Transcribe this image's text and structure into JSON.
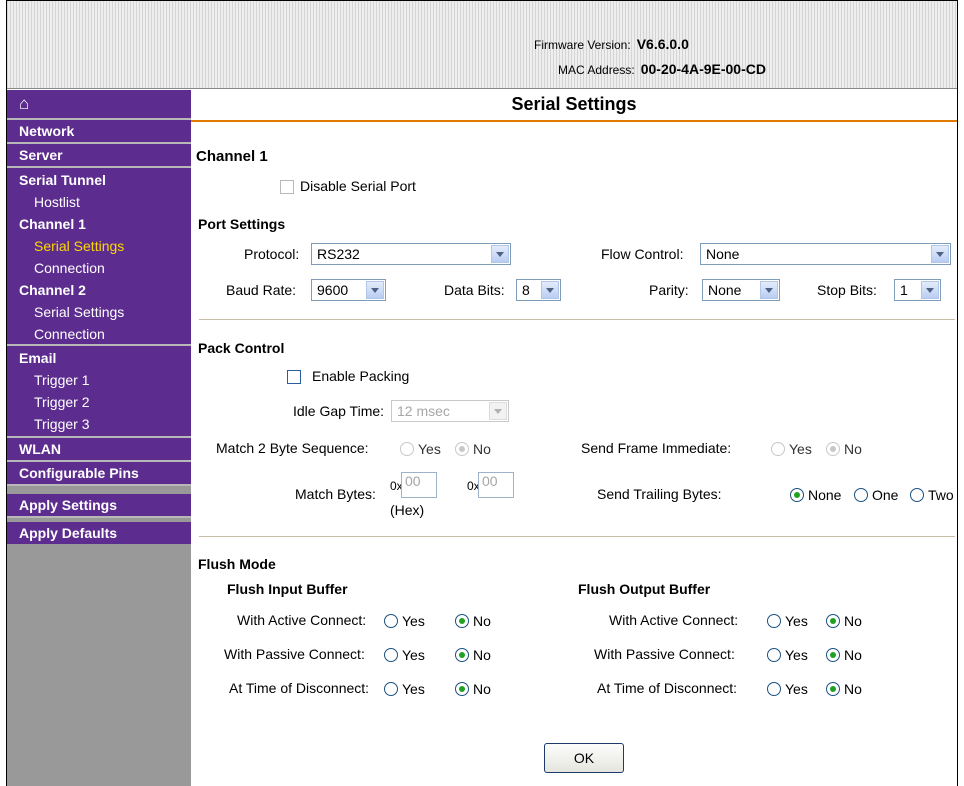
{
  "header": {
    "firmware_label": "Firmware Version:",
    "firmware_value": "V6.6.0.0",
    "mac_label": "MAC Address:",
    "mac_value": "00-20-4A-9E-00-CD"
  },
  "sidebar": {
    "home_icon": "home-icon",
    "network": "Network",
    "server": "Server",
    "serial_tunnel": "Serial Tunnel",
    "hostlist": "Hostlist",
    "channel1": "Channel 1",
    "ch1_serial_settings": "Serial Settings",
    "ch1_connection": "Connection",
    "channel2": "Channel 2",
    "ch2_serial_settings": "Serial Settings",
    "ch2_connection": "Connection",
    "email": "Email",
    "trigger1": "Trigger 1",
    "trigger2": "Trigger 2",
    "trigger3": "Trigger 3",
    "wlan": "WLAN",
    "configurable_pins": "Configurable Pins",
    "apply_settings": "Apply Settings",
    "apply_defaults": "Apply Defaults",
    "active_item_color": "#ffd700",
    "bg_color": "#5c2d8e"
  },
  "page": {
    "title": "Serial Settings",
    "accent_color": "#e07b00"
  },
  "channel": {
    "title": "Channel 1",
    "disable_label": "Disable Serial Port",
    "disable_checked": false
  },
  "port": {
    "title": "Port Settings",
    "protocol_label": "Protocol:",
    "protocol_value": "RS232",
    "flow_label": "Flow Control:",
    "flow_value": "None",
    "baud_label": "Baud Rate:",
    "baud_value": "9600",
    "databits_label": "Data Bits:",
    "databits_value": "8",
    "parity_label": "Parity:",
    "parity_value": "None",
    "stopbits_label": "Stop Bits:",
    "stopbits_value": "1"
  },
  "pack": {
    "title": "Pack Control",
    "enable_label": "Enable Packing",
    "enable_checked": false,
    "idle_label": "Idle Gap Time:",
    "idle_value": "12 msec",
    "match2_label": "Match 2 Byte Sequence:",
    "match2_yes": "Yes",
    "match2_no": "No",
    "sendframe_label": "Send Frame Immediate:",
    "sendframe_yes": "Yes",
    "sendframe_no": "No",
    "matchbytes_label": "Match Bytes:",
    "hex_prefix1": "0x",
    "hex_value1": "00",
    "hex_prefix2": "0x",
    "hex_value2": "00",
    "hex_note": "(Hex)",
    "trailing_label": "Send Trailing Bytes:",
    "trailing_none": "None",
    "trailing_one": "One",
    "trailing_two": "Two"
  },
  "flush": {
    "title": "Flush Mode",
    "input_title": "Flush Input Buffer",
    "output_title": "Flush Output Buffer",
    "active_label": "With Active Connect:",
    "passive_label": "With Passive Connect:",
    "disconnect_label": "At Time of Disconnect:",
    "yes": "Yes",
    "no": "No"
  },
  "ok_label": "OK"
}
